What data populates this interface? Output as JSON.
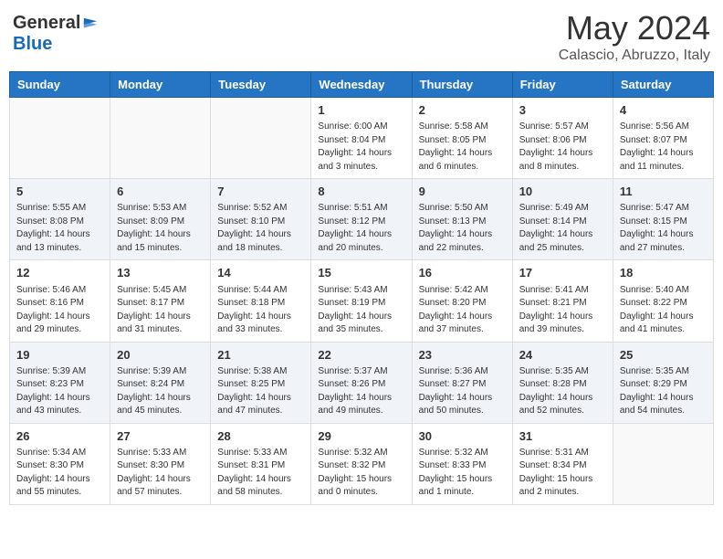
{
  "logo": {
    "general": "General",
    "blue": "Blue"
  },
  "title": "May 2024",
  "subtitle": "Calascio, Abruzzo, Italy",
  "days_of_week": [
    "Sunday",
    "Monday",
    "Tuesday",
    "Wednesday",
    "Thursday",
    "Friday",
    "Saturday"
  ],
  "weeks": [
    [
      {
        "day": "",
        "info": ""
      },
      {
        "day": "",
        "info": ""
      },
      {
        "day": "",
        "info": ""
      },
      {
        "day": "1",
        "info": "Sunrise: 6:00 AM\nSunset: 8:04 PM\nDaylight: 14 hours\nand 3 minutes."
      },
      {
        "day": "2",
        "info": "Sunrise: 5:58 AM\nSunset: 8:05 PM\nDaylight: 14 hours\nand 6 minutes."
      },
      {
        "day": "3",
        "info": "Sunrise: 5:57 AM\nSunset: 8:06 PM\nDaylight: 14 hours\nand 8 minutes."
      },
      {
        "day": "4",
        "info": "Sunrise: 5:56 AM\nSunset: 8:07 PM\nDaylight: 14 hours\nand 11 minutes."
      }
    ],
    [
      {
        "day": "5",
        "info": "Sunrise: 5:55 AM\nSunset: 8:08 PM\nDaylight: 14 hours\nand 13 minutes."
      },
      {
        "day": "6",
        "info": "Sunrise: 5:53 AM\nSunset: 8:09 PM\nDaylight: 14 hours\nand 15 minutes."
      },
      {
        "day": "7",
        "info": "Sunrise: 5:52 AM\nSunset: 8:10 PM\nDaylight: 14 hours\nand 18 minutes."
      },
      {
        "day": "8",
        "info": "Sunrise: 5:51 AM\nSunset: 8:12 PM\nDaylight: 14 hours\nand 20 minutes."
      },
      {
        "day": "9",
        "info": "Sunrise: 5:50 AM\nSunset: 8:13 PM\nDaylight: 14 hours\nand 22 minutes."
      },
      {
        "day": "10",
        "info": "Sunrise: 5:49 AM\nSunset: 8:14 PM\nDaylight: 14 hours\nand 25 minutes."
      },
      {
        "day": "11",
        "info": "Sunrise: 5:47 AM\nSunset: 8:15 PM\nDaylight: 14 hours\nand 27 minutes."
      }
    ],
    [
      {
        "day": "12",
        "info": "Sunrise: 5:46 AM\nSunset: 8:16 PM\nDaylight: 14 hours\nand 29 minutes."
      },
      {
        "day": "13",
        "info": "Sunrise: 5:45 AM\nSunset: 8:17 PM\nDaylight: 14 hours\nand 31 minutes."
      },
      {
        "day": "14",
        "info": "Sunrise: 5:44 AM\nSunset: 8:18 PM\nDaylight: 14 hours\nand 33 minutes."
      },
      {
        "day": "15",
        "info": "Sunrise: 5:43 AM\nSunset: 8:19 PM\nDaylight: 14 hours\nand 35 minutes."
      },
      {
        "day": "16",
        "info": "Sunrise: 5:42 AM\nSunset: 8:20 PM\nDaylight: 14 hours\nand 37 minutes."
      },
      {
        "day": "17",
        "info": "Sunrise: 5:41 AM\nSunset: 8:21 PM\nDaylight: 14 hours\nand 39 minutes."
      },
      {
        "day": "18",
        "info": "Sunrise: 5:40 AM\nSunset: 8:22 PM\nDaylight: 14 hours\nand 41 minutes."
      }
    ],
    [
      {
        "day": "19",
        "info": "Sunrise: 5:39 AM\nSunset: 8:23 PM\nDaylight: 14 hours\nand 43 minutes."
      },
      {
        "day": "20",
        "info": "Sunrise: 5:39 AM\nSunset: 8:24 PM\nDaylight: 14 hours\nand 45 minutes."
      },
      {
        "day": "21",
        "info": "Sunrise: 5:38 AM\nSunset: 8:25 PM\nDaylight: 14 hours\nand 47 minutes."
      },
      {
        "day": "22",
        "info": "Sunrise: 5:37 AM\nSunset: 8:26 PM\nDaylight: 14 hours\nand 49 minutes."
      },
      {
        "day": "23",
        "info": "Sunrise: 5:36 AM\nSunset: 8:27 PM\nDaylight: 14 hours\nand 50 minutes."
      },
      {
        "day": "24",
        "info": "Sunrise: 5:35 AM\nSunset: 8:28 PM\nDaylight: 14 hours\nand 52 minutes."
      },
      {
        "day": "25",
        "info": "Sunrise: 5:35 AM\nSunset: 8:29 PM\nDaylight: 14 hours\nand 54 minutes."
      }
    ],
    [
      {
        "day": "26",
        "info": "Sunrise: 5:34 AM\nSunset: 8:30 PM\nDaylight: 14 hours\nand 55 minutes."
      },
      {
        "day": "27",
        "info": "Sunrise: 5:33 AM\nSunset: 8:30 PM\nDaylight: 14 hours\nand 57 minutes."
      },
      {
        "day": "28",
        "info": "Sunrise: 5:33 AM\nSunset: 8:31 PM\nDaylight: 14 hours\nand 58 minutes."
      },
      {
        "day": "29",
        "info": "Sunrise: 5:32 AM\nSunset: 8:32 PM\nDaylight: 15 hours\nand 0 minutes."
      },
      {
        "day": "30",
        "info": "Sunrise: 5:32 AM\nSunset: 8:33 PM\nDaylight: 15 hours\nand 1 minute."
      },
      {
        "day": "31",
        "info": "Sunrise: 5:31 AM\nSunset: 8:34 PM\nDaylight: 15 hours\nand 2 minutes."
      },
      {
        "day": "",
        "info": ""
      }
    ]
  ]
}
